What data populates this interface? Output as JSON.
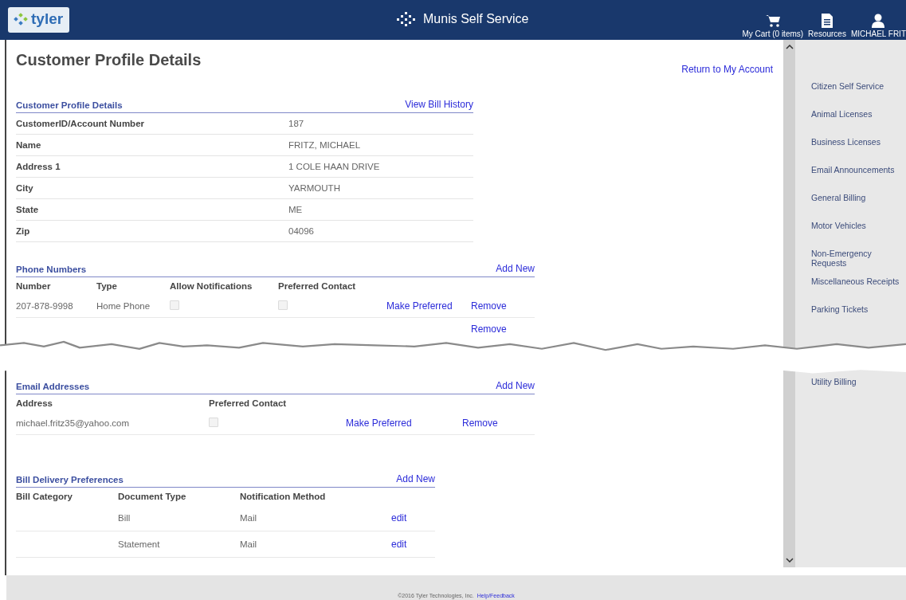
{
  "header": {
    "logo": "tyler",
    "app_title": "Munis Self Service",
    "links": [
      {
        "kind": "cart",
        "label": "My Cart (0 items)"
      },
      {
        "kind": "resources",
        "label": "Resources"
      },
      {
        "kind": "user",
        "label": "MICHAEL FRIT"
      }
    ]
  },
  "page_title": "Customer Profile Details",
  "return_link": "Return to My Account",
  "profile": {
    "title": "Customer Profile Details",
    "link": "View Bill History",
    "rows": [
      {
        "label": "CustomerID/Account Number",
        "value": "187"
      },
      {
        "label": "Name",
        "value": "FRITZ, MICHAEL"
      },
      {
        "label": "Address 1",
        "value": "1 COLE HAAN DRIVE"
      },
      {
        "label": "City",
        "value": "YARMOUTH"
      },
      {
        "label": "State",
        "value": "ME"
      },
      {
        "label": "Zip",
        "value": "04096"
      }
    ]
  },
  "phones": {
    "title": "Phone Numbers",
    "link": "Add New",
    "columns": [
      "Number",
      "Type",
      "Allow Notifications",
      "Preferred Contact"
    ],
    "rows": [
      {
        "number": "207-878-9998",
        "type": "Home Phone",
        "allow_notifications": {
          "checked": false,
          "disabled": true
        },
        "preferred": {
          "checked": false,
          "disabled": true
        },
        "make_preferred": "Make Preferred",
        "remove": "Remove"
      }
    ],
    "torn_row_link": "Remove"
  },
  "emails": {
    "title": "Email Addresses",
    "link": "Add New",
    "columns": [
      "Address",
      "Preferred Contact"
    ],
    "rows": [
      {
        "address": "michael.fritz35@yahoo.com",
        "preferred": {
          "checked": false,
          "disabled": true
        },
        "make_preferred": "Make Preferred",
        "remove": "Remove"
      }
    ]
  },
  "bill_delivery": {
    "title": "Bill Delivery Preferences",
    "link": "Add New",
    "columns": [
      "Bill Category",
      "Document Type",
      "Notification Method"
    ],
    "rows": [
      {
        "category": "",
        "document_type": "Bill",
        "method": "Mail",
        "action": "edit"
      },
      {
        "category": "",
        "document_type": "Statement",
        "method": "Mail",
        "action": "edit"
      }
    ]
  },
  "sidebar": {
    "items_above_tear": [
      "Citizen Self Service",
      "Animal Licenses",
      "Business Licenses",
      "Email Announcements",
      "General Billing",
      "Motor Vehicles",
      "Non-Emergency Requests",
      "Miscellaneous Receipts",
      "Parking Tickets"
    ],
    "items_below_tear": [
      "Utility Billing"
    ]
  },
  "footer": {
    "copyright": "©2016 Tyler Technologies, Inc.",
    "link": "Help/Feedback"
  }
}
